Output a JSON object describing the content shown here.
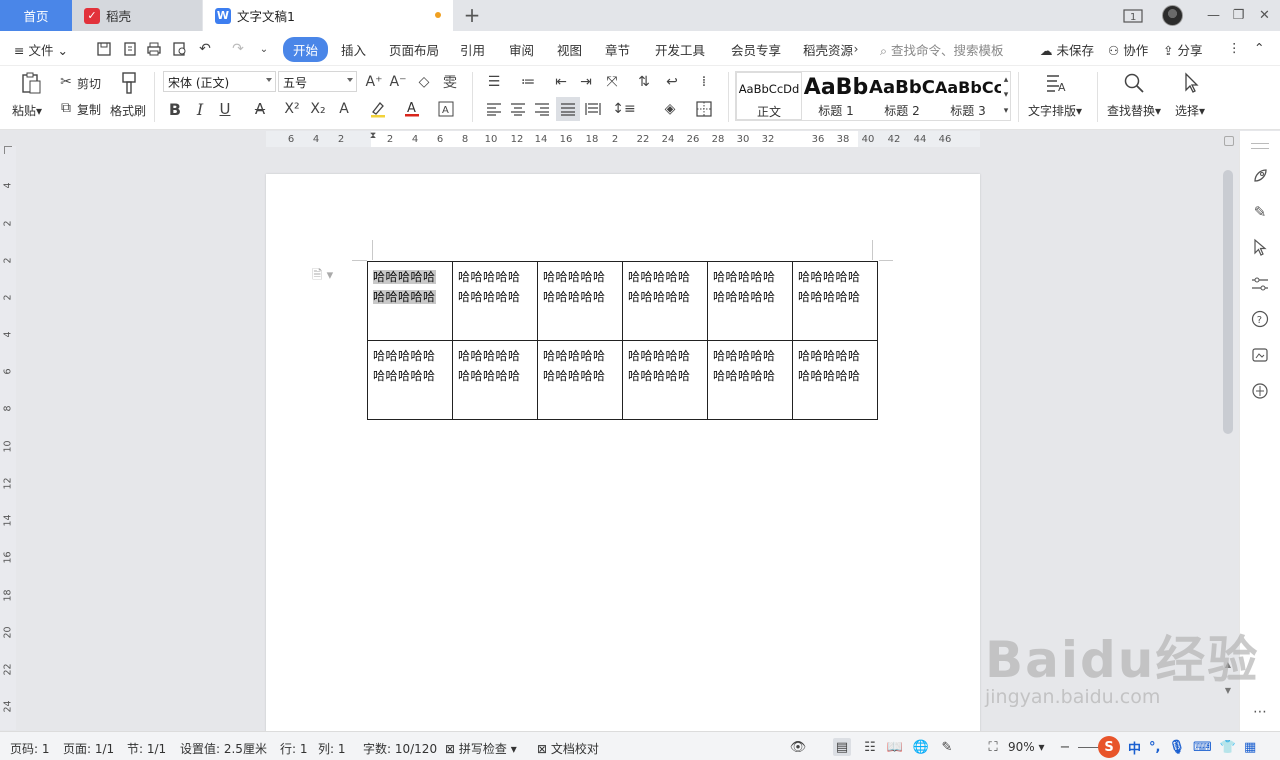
{
  "tabs": {
    "home": "首页",
    "doc1": "稻壳",
    "doc2": "文字文稿1"
  },
  "menubar": {
    "file": "文件",
    "items": [
      "开始",
      "插入",
      "页面布局",
      "引用",
      "审阅",
      "视图",
      "章节",
      "开发工具",
      "会员专享",
      "稻壳资源"
    ],
    "search_placeholder": "查找命令、搜索模板",
    "unsaved": "未保存",
    "collab": "协作",
    "share": "分享"
  },
  "ribbon": {
    "paste": "粘贴",
    "cut": "剪切",
    "copy": "复制",
    "format_painter": "格式刷",
    "font_name": "宋体 (正文)",
    "font_size": "五号",
    "styles": [
      {
        "preview": "AaBbCcDd",
        "name": "正文"
      },
      {
        "preview": "AaBb",
        "name": "标题 1"
      },
      {
        "preview": "AaBbC",
        "name": "标题 2"
      },
      {
        "preview": "AaBbCc",
        "name": "标题 3"
      }
    ],
    "text_layout": "文字排版",
    "find_replace": "查找替换",
    "select": "选择"
  },
  "ruler": {
    "h_ticks": [
      "6",
      "4",
      "2",
      "2",
      "4",
      "6",
      "8",
      "10",
      "12",
      "14",
      "16",
      "18",
      "2",
      "22",
      "24",
      "26",
      "28",
      "30",
      "32",
      "36",
      "38",
      "40",
      "42",
      "44",
      "46"
    ],
    "v_ticks": [
      "4",
      "2",
      "2",
      "2",
      "4",
      "6",
      "8",
      "10",
      "12",
      "14",
      "16",
      "18",
      "20",
      "22",
      "24"
    ]
  },
  "table": {
    "rows": [
      [
        "哈哈哈哈哈哈哈哈哈哈",
        "哈哈哈哈哈哈哈哈哈哈",
        "哈哈哈哈哈哈哈哈哈哈",
        "哈哈哈哈哈哈哈哈哈哈",
        "哈哈哈哈哈哈哈哈哈哈",
        "哈哈哈哈哈哈哈哈哈哈"
      ],
      [
        "哈哈哈哈哈哈哈哈哈哈",
        "哈哈哈哈哈哈哈哈哈哈",
        "哈哈哈哈哈哈哈哈哈哈",
        "哈哈哈哈哈哈哈哈哈哈",
        "哈哈哈哈哈哈哈哈哈哈",
        "哈哈哈哈哈哈哈哈哈哈"
      ]
    ]
  },
  "status": {
    "page_num": "页码: 1",
    "page": "页面: 1/1",
    "section": "节: 1/1",
    "setting": "设置值: 2.5厘米",
    "row": "行: 1",
    "col": "列: 1",
    "words": "字数: 10/120",
    "spell": "拼写检查",
    "proof": "文档校对",
    "zoom": "90%"
  },
  "ime": {
    "lang": "中",
    "punct": "°,"
  },
  "watermark": {
    "brand": "Baidu经验",
    "url": "jingyan.baidu.com"
  },
  "colors": {
    "accent": "#4a86e8",
    "tab_red": "#e2323b",
    "dot": "#f0a020"
  }
}
